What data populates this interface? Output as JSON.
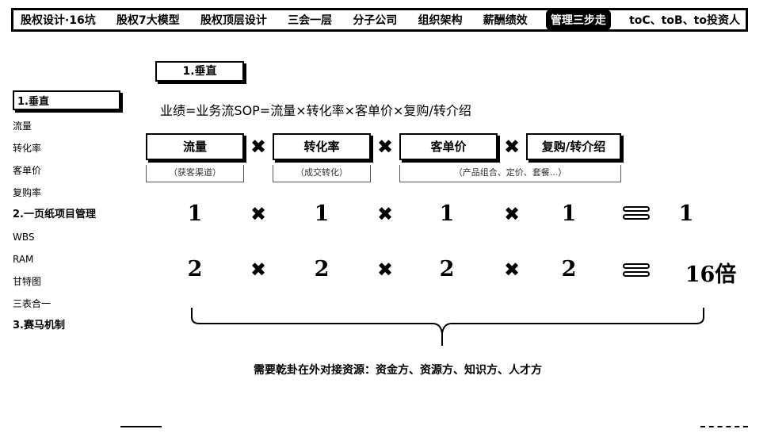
{
  "nav": {
    "items": [
      "股权设计·16坑",
      "股权7大模型",
      "股权顶层设计",
      "三会一层",
      "分子公司",
      "组织架构",
      "薪酬绩效",
      "管理三步走",
      "toC、toB、to投资人"
    ],
    "active_index": 7
  },
  "sidebar": {
    "active": "1.垂直",
    "items": [
      {
        "label": "流量",
        "section": false
      },
      {
        "label": "转化率",
        "section": false
      },
      {
        "label": "客单价",
        "section": false
      },
      {
        "label": "复购率",
        "section": false
      },
      {
        "label": "2.一页纸项目管理",
        "section": true
      },
      {
        "label": "WBS",
        "section": false
      },
      {
        "label": "RAM",
        "section": false
      },
      {
        "label": "甘特图",
        "section": false
      },
      {
        "label": "三表合一",
        "section": false
      },
      {
        "label": "3.赛马机制",
        "section": true
      }
    ]
  },
  "main": {
    "heading": "1.垂直",
    "formula": "业绩=业务流SOP=流量×转化率×客单价×复购/转介绍",
    "factors": [
      {
        "label": "流量",
        "note": "（获客渠道）"
      },
      {
        "label": "转化率",
        "note": "（成交转化）"
      },
      {
        "label": "客单价",
        "note": "（产品组合、定价、套餐...）"
      },
      {
        "label": "复购/转介绍",
        "note": ""
      }
    ],
    "times_symbol": "✖",
    "row1": [
      "1",
      "1",
      "1",
      "1",
      "1"
    ],
    "row2": [
      "2",
      "2",
      "2",
      "2",
      "16倍"
    ],
    "note": "需要乾卦在外对接资源：资金方、资源方、知识方、人才方"
  }
}
